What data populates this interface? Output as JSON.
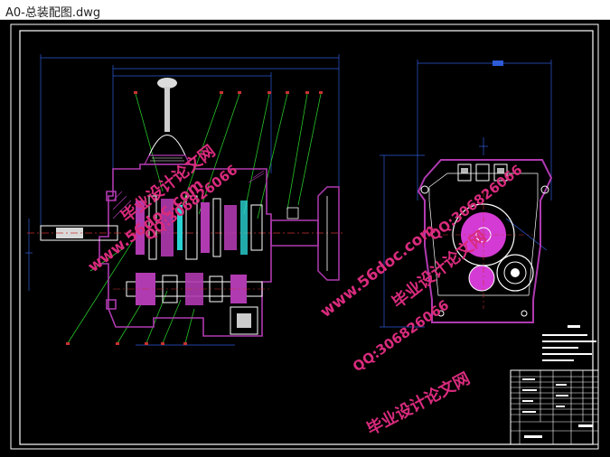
{
  "window": {
    "title": "A0-总装配图.dwg"
  },
  "drawing": {
    "watermark_site": "www.56doc.com",
    "watermark_qq": "QQ:306826066",
    "watermark_brand": "毕业设计论文网"
  },
  "colors": {
    "background": "#000000",
    "frame": "#ffffff",
    "part_outline": "#b03ab0",
    "dimension": "#2e5bd8",
    "leader": "#27c427",
    "centerline": "#c83232",
    "gear_fill": "#d43bd4",
    "watermark": "#d92b7d"
  }
}
